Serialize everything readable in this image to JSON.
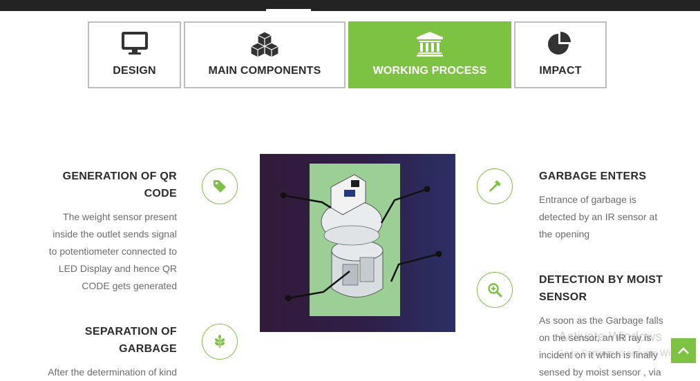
{
  "tabs": [
    {
      "label": "DESIGN",
      "icon": "monitor-icon",
      "active": false
    },
    {
      "label": "MAIN COMPONENTS",
      "icon": "cubes-icon",
      "active": false
    },
    {
      "label": "WORKING PROCESS",
      "icon": "bank-icon",
      "active": true
    },
    {
      "label": "IMPACT",
      "icon": "pie-chart-icon",
      "active": false
    }
  ],
  "colors": {
    "accent": "#7dc242",
    "topbar": "#232323",
    "body_text": "#6b6b6b",
    "heading": "#2b2b2b"
  },
  "steps_left": [
    {
      "title_line1": "GENERATION OF QR",
      "title_line2": "CODE",
      "text_lines": [
        "The weight sensor present",
        "inside the outlet sends signal",
        "to potentiometer connected to",
        "LED Display and hence QR",
        "CODE gets generated"
      ],
      "icon": "tag-icon"
    },
    {
      "title_line1": "SEPARATION OF",
      "title_line2": "GARBAGE",
      "text_lines": [
        "After the determination of kind"
      ],
      "icon": "leaf-icon"
    }
  ],
  "steps_right": [
    {
      "title_line1": "GARBAGE ENTERS",
      "text_lines": [
        "Entrance of garbage is",
        "detected by an IR sensor at",
        "the opening"
      ],
      "icon": "eyedropper-icon"
    },
    {
      "title_line1": "DETECTION BY MOIST",
      "title_line2": "SENSOR",
      "text_lines": [
        "As soon as the Garbage falls",
        "on the sensor, an IR ray is",
        "incident on it which is finally",
        "sensed by moist sensor , via"
      ],
      "icon": "zoom-in-icon"
    }
  ],
  "watermark": {
    "line1": "Activate Windows",
    "line2": "Go to Settings to activate Windows."
  },
  "back_to_top_icon": "chevron-up-icon"
}
